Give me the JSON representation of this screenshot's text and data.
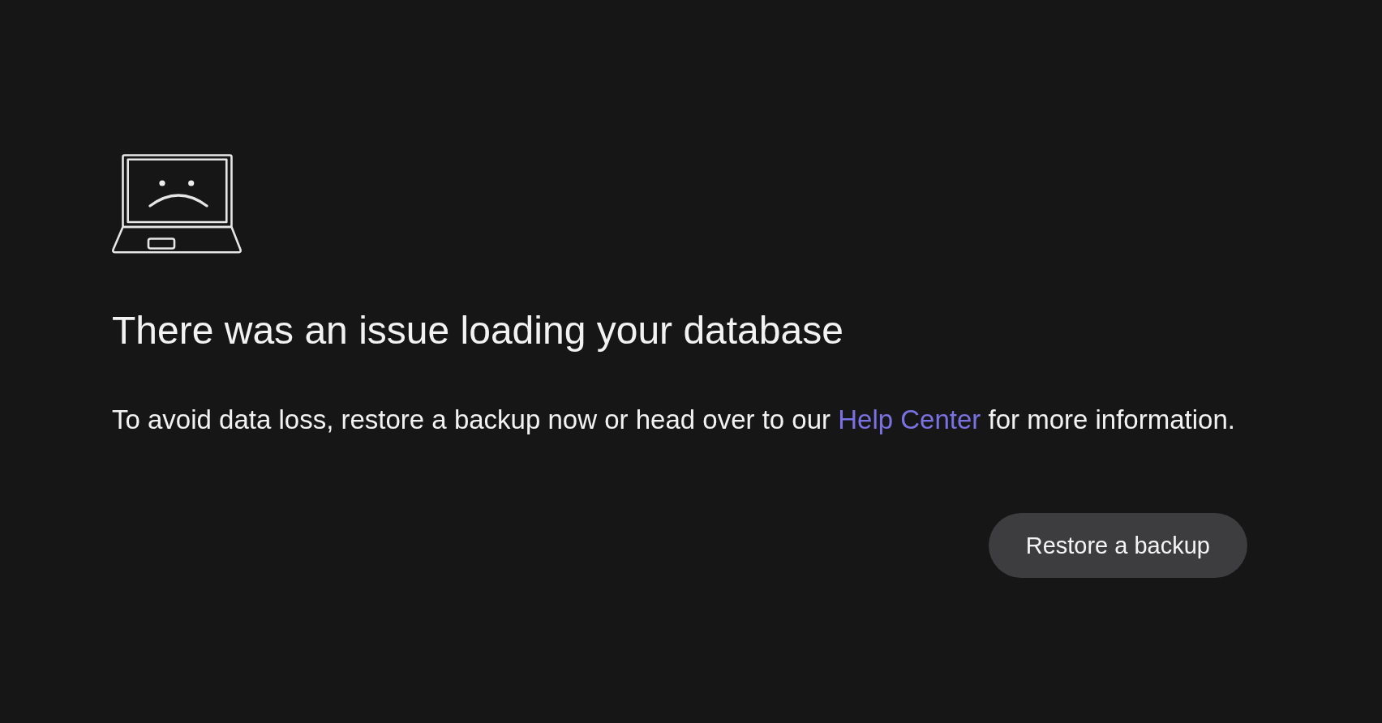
{
  "error": {
    "heading": "There was an issue loading your database",
    "message": {
      "before": "To avoid data loss, restore a backup now or head over to our",
      "link": "Help Center",
      "after": "for more information."
    },
    "buttons": [
      {
        "label": "Restore a backup"
      }
    ]
  }
}
